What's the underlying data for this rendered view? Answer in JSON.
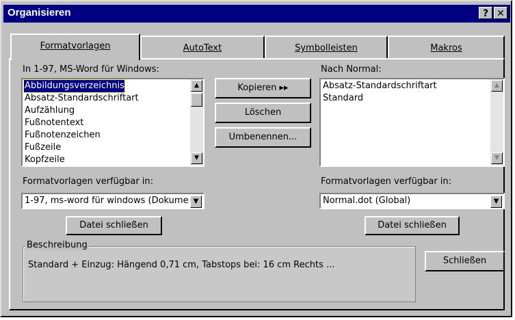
{
  "window": {
    "title": "Organisieren",
    "help_glyph": "?",
    "close_glyph": "✕"
  },
  "tabs": [
    {
      "label": "Formatvorlagen"
    },
    {
      "label": "AutoText"
    },
    {
      "label": "Symbolleisten"
    },
    {
      "label": "Makros"
    }
  ],
  "left": {
    "label": "In 1-97, MS-Word für Windows:",
    "items": [
      "Abbildungsverzeichnis",
      "Absatz-Standardschriftart",
      "Aufzählung",
      "Fußnotentext",
      "Fußnotenzeichen",
      "Fußzeile",
      "Kopfzeile"
    ],
    "available_label": "Formatvorlagen verfügbar in:",
    "available_value": "1-97, ms-word für windows (Dokume",
    "close_file": "Datei schließen"
  },
  "right": {
    "label": "Nach Normal:",
    "items": [
      "Absatz-Standardschriftart",
      "Standard"
    ],
    "available_label": "Formatvorlagen verfügbar in:",
    "available_value": "Normal.dot (Global)",
    "close_file": "Datei schließen"
  },
  "actions": {
    "copy": "Kopieren ▸▸",
    "delete": "Löschen",
    "rename": "Umbenennen..."
  },
  "description": {
    "label": "Beschreibung",
    "text": "Standard + Einzug:  Hängend  0,71 cm, Tabstops bei: 16 cm Rechts ..."
  },
  "close_button": "Schließen",
  "scroll_icons": {
    "up": "▲",
    "down": "▼"
  }
}
